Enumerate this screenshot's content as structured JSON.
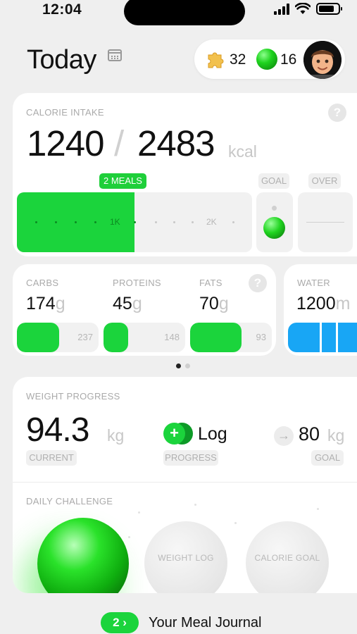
{
  "status_bar": {
    "time": "12:04"
  },
  "header": {
    "title": "Today",
    "puzzle_count": "32",
    "orb_count": "16"
  },
  "calorie": {
    "label": "CALORIE INTAKE",
    "help": "?",
    "consumed": "1240",
    "separator": "/",
    "goal": "2483",
    "unit": "kcal",
    "meals_badge": "2 MEALS",
    "goal_tag": "GOAL",
    "over_tag": "OVER",
    "tick_1k": "1K",
    "tick_2k": "2K",
    "progress_fraction": 0.5
  },
  "macros": {
    "help": "?",
    "carbs": {
      "label": "CARBS",
      "value": "174",
      "unit": "g",
      "total": "237",
      "fraction": 0.52
    },
    "proteins": {
      "label": "PROTEINS",
      "value": "45",
      "unit": "g",
      "total": "148",
      "fraction": 0.3
    },
    "fats": {
      "label": "FATS",
      "value": "70",
      "unit": "g",
      "total": "93",
      "fraction": 0.63
    }
  },
  "water": {
    "label": "WATER",
    "value": "1200",
    "unit": "m"
  },
  "pager": {
    "active": 0,
    "count": 2
  },
  "weight": {
    "label": "WEIGHT PROGRESS",
    "current": "94.3",
    "current_unit": "kg",
    "current_tag": "CURRENT",
    "log_plus": "+",
    "log_label": "Log",
    "progress_tag": "PROGRESS",
    "arrow": "→",
    "goal": "80",
    "goal_unit": "kg",
    "goal_tag": "GOAL"
  },
  "challenge": {
    "label": "DAILY CHALLENGE",
    "items": [
      {
        "label": "WEIGHT LOG"
      },
      {
        "label": "CALORIE GOAL"
      }
    ]
  },
  "journal": {
    "badge": "2 ›",
    "label": "Your Meal Journal"
  },
  "colors": {
    "accent": "#1bd43c",
    "water": "#18a6f5",
    "background": "#efefef"
  }
}
